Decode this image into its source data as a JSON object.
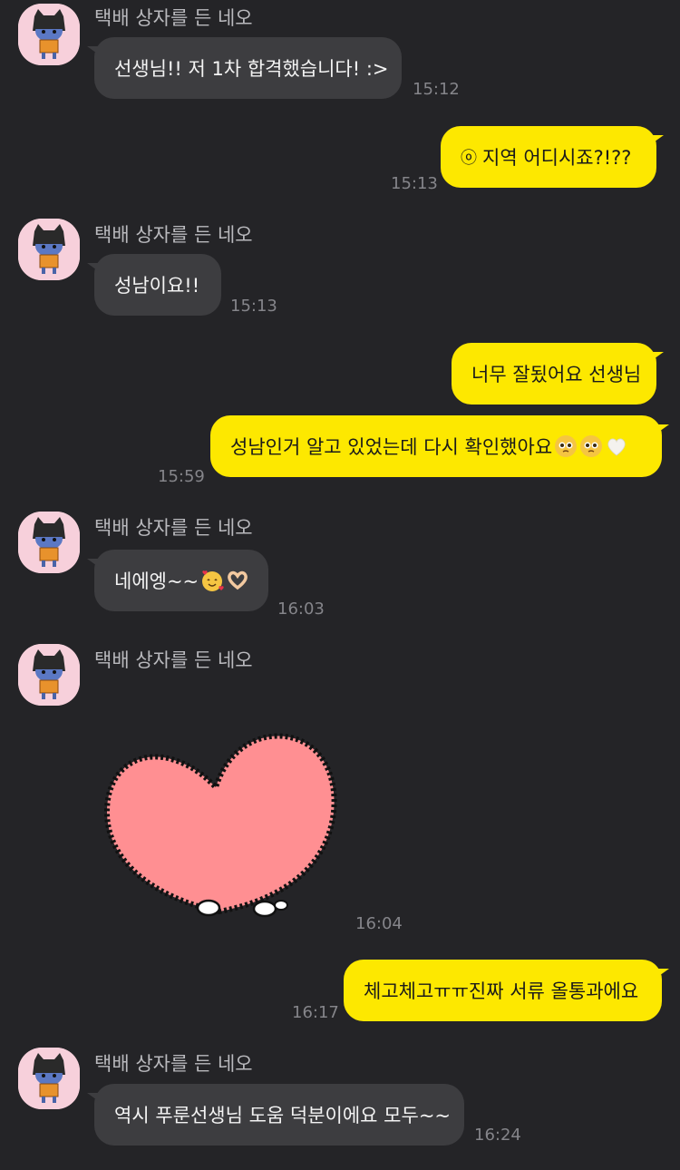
{
  "chat": {
    "sender_name": "택배 상자를 든 네오",
    "messages": [
      {
        "text": "선생님!! 저 1차 합격했습니다! :>",
        "time": "15:12"
      },
      {
        "text": "지역 어디시죠?!??",
        "time": "15:13"
      },
      {
        "text": "성남이요!!",
        "time": "15:13"
      },
      {
        "text": "너무 잘됬어요 선생님"
      },
      {
        "text": "성남인거 알고 있었는데 다시 확인했아요",
        "time": "15:59"
      },
      {
        "text": "네에엥~~",
        "time": "16:03"
      },
      {
        "time": "16:04"
      },
      {
        "text": "체고체고ㅠㅠ진짜 서류 올통과에요",
        "time": "16:17"
      },
      {
        "text": "역시 푸룬선생님 도움 덕분이에요 모두~~",
        "time": "16:24"
      }
    ]
  },
  "colors": {
    "background": "#242427",
    "incoming_bubble": "#3d3d40",
    "outgoing_bubble": "#fde800",
    "sticker_heart": "#ff8f92"
  }
}
